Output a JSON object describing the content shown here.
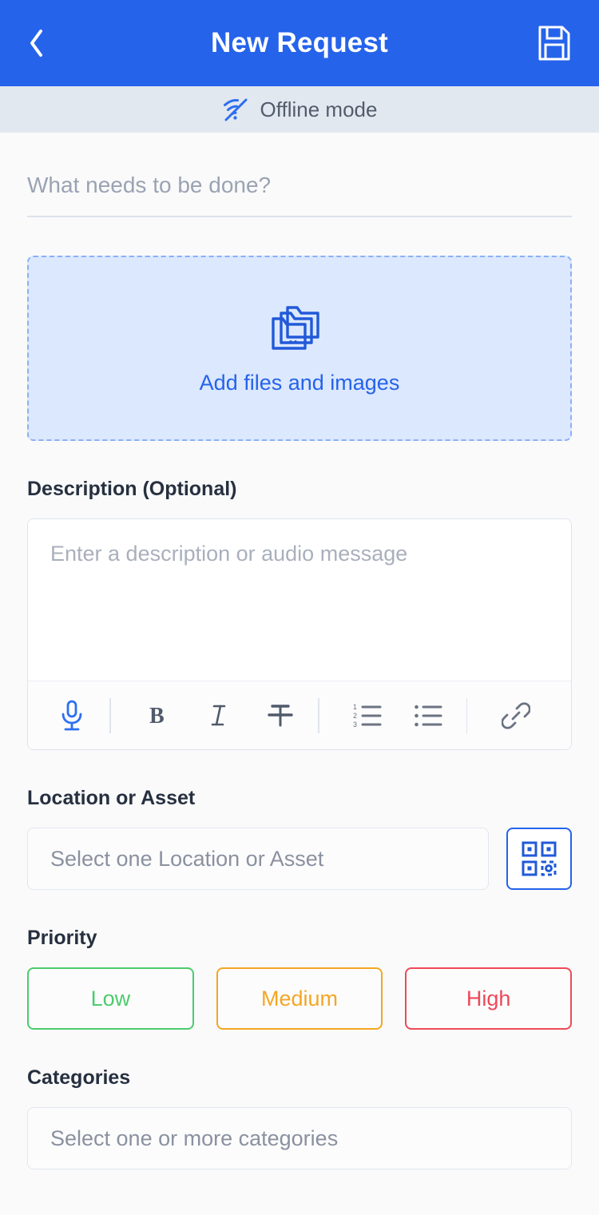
{
  "header": {
    "title": "New Request",
    "back_icon": "chevron-left-icon",
    "save_icon": "floppy-save-icon"
  },
  "offline": {
    "label": "Offline mode",
    "icon": "wifi-off-icon",
    "icon_color": "#2563EB",
    "bar_color": "#E2E8F0"
  },
  "title_field": {
    "value": "",
    "placeholder": "What needs to be done?"
  },
  "upload": {
    "label": "Add files and images",
    "icon": "folders-icon",
    "accent": "#2563EB",
    "fill": "#DCE8FD",
    "border": "#8AB0F5"
  },
  "description": {
    "label": "Description (Optional)",
    "value": "",
    "placeholder": "Enter a description or audio message",
    "toolbar": [
      {
        "name": "microphone-icon",
        "label": "Record audio",
        "active": true
      },
      {
        "name": "bold-icon",
        "label": "Bold",
        "active": false
      },
      {
        "name": "italic-icon",
        "label": "Italic",
        "active": false
      },
      {
        "name": "strikethrough-icon",
        "label": "Strikethrough",
        "active": false
      },
      {
        "name": "ordered-list-icon",
        "label": "Numbered list",
        "active": false
      },
      {
        "name": "unordered-list-icon",
        "label": "Bulleted list",
        "active": false
      },
      {
        "name": "link-icon",
        "label": "Insert link",
        "active": false
      }
    ]
  },
  "location": {
    "label": "Location or Asset",
    "value": "",
    "placeholder": "Select one Location or Asset",
    "qr_icon": "qr-code-scan-icon"
  },
  "priority": {
    "label": "Priority",
    "selected": "",
    "options": [
      {
        "label": "Low",
        "color": "#4CCB6C"
      },
      {
        "label": "Medium",
        "color": "#F5A623"
      },
      {
        "label": "High",
        "color": "#EE4957"
      }
    ]
  },
  "categories": {
    "label": "Categories",
    "value": "",
    "placeholder": "Select one or more categories"
  },
  "theme": {
    "primary": "#2563EB",
    "page_bg": "#FAFAFB",
    "text": "#26303F",
    "muted": "#8A919F"
  }
}
